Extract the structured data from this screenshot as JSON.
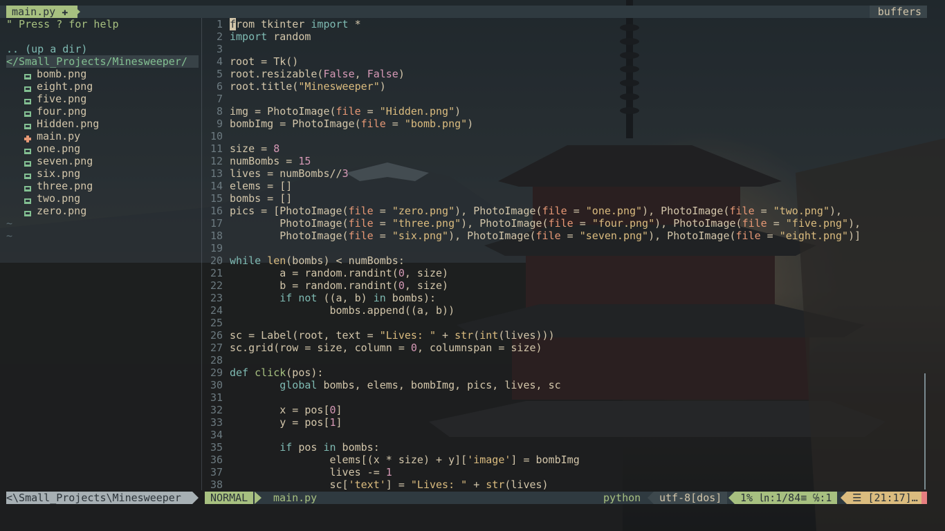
{
  "tabline": {
    "active_tab": "main.py ✚",
    "buffers_label": "buffers"
  },
  "nerdtree": {
    "help": "\" Press ? for help",
    "up_dir": ".. (up a dir)",
    "root": "</Small_Projects/Minesweeper/",
    "files": [
      {
        "name": "bomb.png",
        "icon": "image-file-icon",
        "color": "#83c092"
      },
      {
        "name": "eight.png",
        "icon": "image-file-icon",
        "color": "#83c092"
      },
      {
        "name": "five.png",
        "icon": "image-file-icon",
        "color": "#83c092"
      },
      {
        "name": "four.png",
        "icon": "image-file-icon",
        "color": "#83c092"
      },
      {
        "name": "Hidden.png",
        "icon": "image-file-icon",
        "color": "#83c092"
      },
      {
        "name": "main.py",
        "icon": "modified-file-icon",
        "color": "#e69875"
      },
      {
        "name": "one.png",
        "icon": "image-file-icon",
        "color": "#83c092"
      },
      {
        "name": "seven.png",
        "icon": "image-file-icon",
        "color": "#83c092"
      },
      {
        "name": "six.png",
        "icon": "image-file-icon",
        "color": "#83c092"
      },
      {
        "name": "three.png",
        "icon": "image-file-icon",
        "color": "#83c092"
      },
      {
        "name": "two.png",
        "icon": "image-file-icon",
        "color": "#83c092"
      },
      {
        "name": "zero.png",
        "icon": "image-file-icon",
        "color": "#83c092"
      }
    ],
    "tildes": [
      "~",
      "~"
    ],
    "statusline": "<\\Small_Projects\\Minesweeper"
  },
  "editor": {
    "lines": [
      {
        "n": "1",
        "code": "from tkinter import *"
      },
      {
        "n": "2",
        "code": "import random"
      },
      {
        "n": "3",
        "code": ""
      },
      {
        "n": "4",
        "code": "root = Tk()"
      },
      {
        "n": "5",
        "code": "root.resizable(False, False)"
      },
      {
        "n": "6",
        "code": "root.title(\"Minesweeper\")"
      },
      {
        "n": "7",
        "code": ""
      },
      {
        "n": "8",
        "code": "img = PhotoImage(file = \"Hidden.png\")"
      },
      {
        "n": "9",
        "code": "bombImg = PhotoImage(file = \"bomb.png\")"
      },
      {
        "n": "10",
        "code": ""
      },
      {
        "n": "11",
        "code": "size = 8"
      },
      {
        "n": "12",
        "code": "numBombs = 15"
      },
      {
        "n": "13",
        "code": "lives = numBombs//3"
      },
      {
        "n": "14",
        "code": "elems = []"
      },
      {
        "n": "15",
        "code": "bombs = []"
      },
      {
        "n": "16",
        "code": "pics = [PhotoImage(file = \"zero.png\"), PhotoImage(file = \"one.png\"), PhotoImage(file = \"two.png\"),"
      },
      {
        "n": "17",
        "code": "        PhotoImage(file = \"three.png\"), PhotoImage(file = \"four.png\"), PhotoImage(file = \"five.png\"),"
      },
      {
        "n": "18",
        "code": "        PhotoImage(file = \"six.png\"), PhotoImage(file = \"seven.png\"), PhotoImage(file = \"eight.png\")]"
      },
      {
        "n": "19",
        "code": ""
      },
      {
        "n": "20",
        "code": "while len(bombs) < numBombs:"
      },
      {
        "n": "21",
        "code": "        a = random.randint(0, size)"
      },
      {
        "n": "22",
        "code": "        b = random.randint(0, size)"
      },
      {
        "n": "23",
        "code": "        if not ((a, b) in bombs):"
      },
      {
        "n": "24",
        "code": "                bombs.append((a, b))"
      },
      {
        "n": "25",
        "code": ""
      },
      {
        "n": "26",
        "code": "sc = Label(root, text = \"Lives: \" + str(int(lives)))"
      },
      {
        "n": "27",
        "code": "sc.grid(row = size, column = 0, columnspan = size)"
      },
      {
        "n": "28",
        "code": ""
      },
      {
        "n": "29",
        "code": "def click(pos):"
      },
      {
        "n": "30",
        "code": "        global bombs, elems, bombImg, pics, lives, sc"
      },
      {
        "n": "31",
        "code": ""
      },
      {
        "n": "32",
        "code": "        x = pos[0]"
      },
      {
        "n": "33",
        "code": "        y = pos[1]"
      },
      {
        "n": "34",
        "code": ""
      },
      {
        "n": "35",
        "code": "        if pos in bombs:"
      },
      {
        "n": "36",
        "code": "                elems[(x * size) + y]['image'] = bombImg"
      },
      {
        "n": "37",
        "code": "                lives -= 1"
      },
      {
        "n": "38",
        "code": "                sc['text'] = \"Lives: \" + str(lives)"
      }
    ]
  },
  "statusline": {
    "mode": "NORMAL",
    "filename": "main.py",
    "filetype": "python",
    "encoding": "utf-8[dos]",
    "position": "1% ㏑:1/84≡  ℅:1",
    "time": "☰ [21:17]…"
  }
}
